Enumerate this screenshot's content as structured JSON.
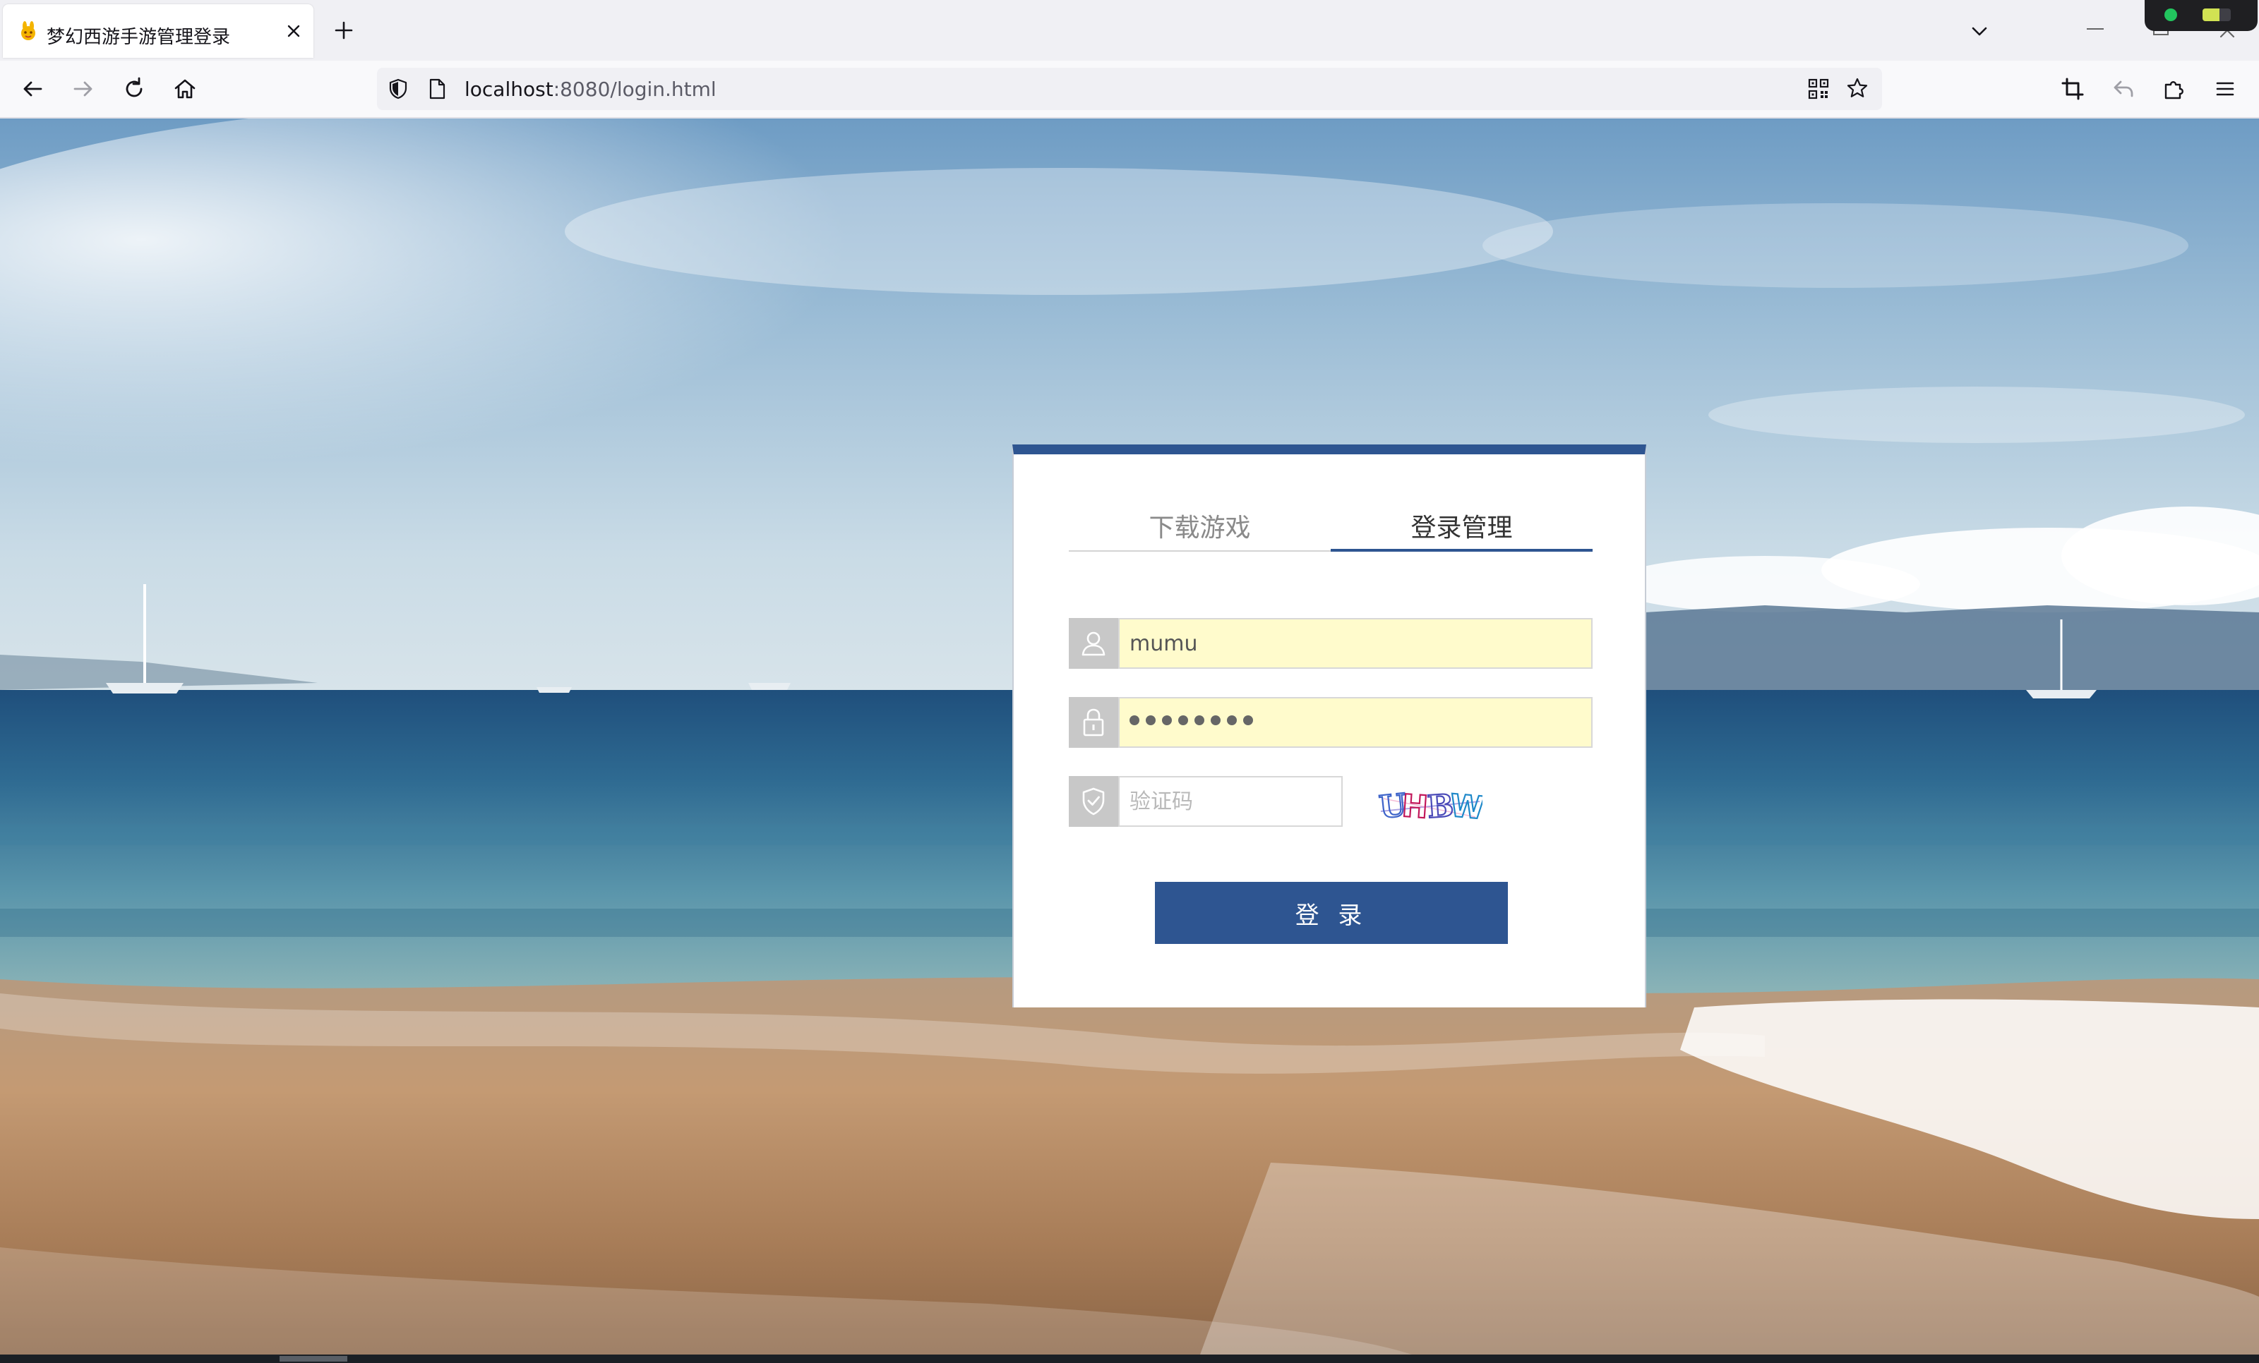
{
  "browser": {
    "tab": {
      "title": "梦幻西游手游管理登录"
    },
    "address": {
      "host": "localhost",
      "rest": ":8080/login.html"
    }
  },
  "login": {
    "tabs": [
      "下载游戏",
      "登录管理"
    ],
    "active_tab": "登录管理",
    "username": {
      "value": "mumu"
    },
    "password": {
      "masked_length": 8
    },
    "captcha": {
      "placeholder": "验证码",
      "image_text": "UHBW"
    },
    "submit_label": "登 录"
  },
  "colors": {
    "accent": "#2e5591",
    "autofill": "#fffbcc"
  }
}
